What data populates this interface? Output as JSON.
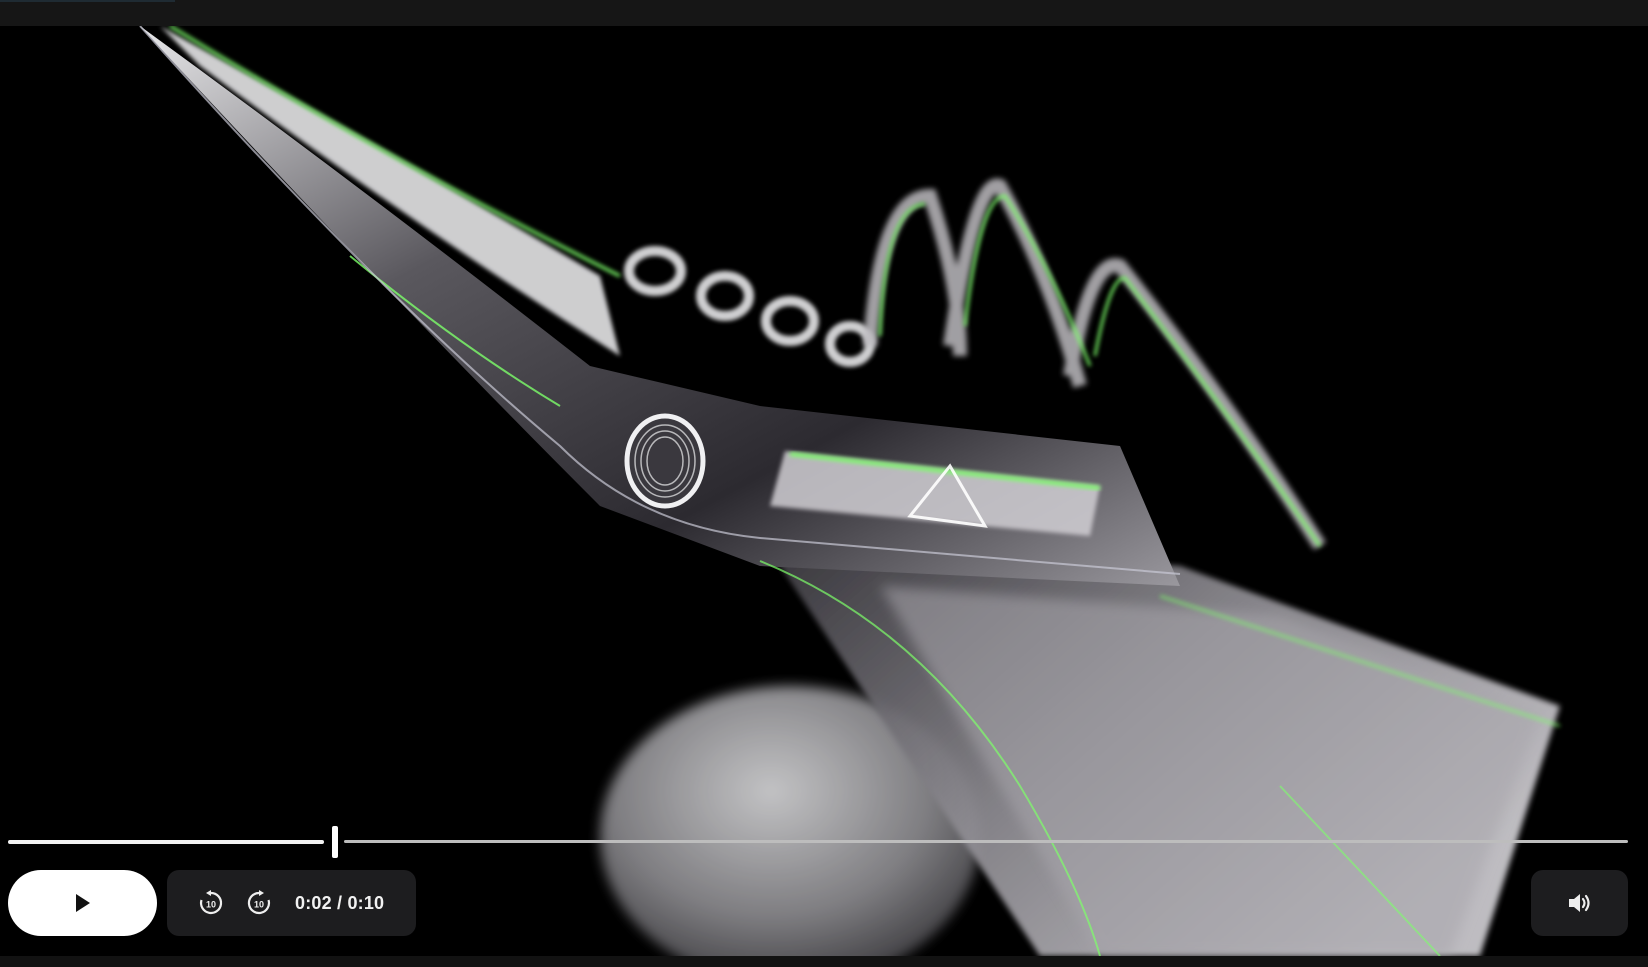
{
  "player": {
    "elapsed": "0:02",
    "separator": " / ",
    "duration": "0:10",
    "progress_fraction": 0.2
  },
  "icons": {
    "play": "play-icon",
    "rewind": "rewind-10-icon",
    "forward": "forward-10-icon",
    "volume": "volume-icon"
  },
  "skip": {
    "rewind_label": "10",
    "forward_label": "10"
  },
  "colors": {
    "rim_light": "#7dff6a",
    "metal": "#b9b7bd",
    "background": "#000000"
  }
}
